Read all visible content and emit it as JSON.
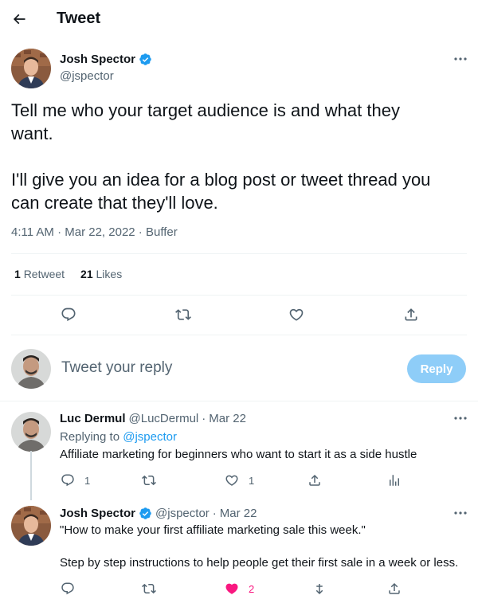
{
  "header": {
    "title": "Tweet"
  },
  "tweet": {
    "author_name": "Josh Spector",
    "author_handle": "@jspector",
    "text": "Tell me who your target audience is and what they\nwant.\n\nI'll give you an idea for a blog post or tweet thread you\ncan create that they'll love.",
    "meta": "4:11 AM · Mar 22, 2022 · Buffer",
    "retweets_count": "1",
    "retweets_label": "Retweet",
    "likes_count": "21",
    "likes_label": "Likes"
  },
  "reply_composer": {
    "placeholder": "Tweet your reply",
    "button_label": "Reply"
  },
  "replies": [
    {
      "name": "Luc Dermul",
      "handle": "@LucDermul",
      "dot": "·",
      "date": "Mar 22",
      "replying_prefix": "Replying to",
      "replying_handle": "@jspector",
      "text": "Affiliate marketing for beginners who want to start it as a side hustle",
      "reply_count": "1",
      "like_count": "1"
    },
    {
      "name": "Josh Spector",
      "handle": "@jspector",
      "dot": "·",
      "date": "Mar 22",
      "text_line1": "\"How to make your first affiliate marketing sale this week.\"",
      "text_line2": "Step by step instructions to help people get their first sale in a week or less.",
      "like_count": "2"
    }
  ],
  "colors": {
    "accent": "#1d9bf0",
    "reply_button_disabled": "#8ecdf8",
    "liked": "#f91880",
    "secondary_text": "#536471"
  },
  "icons": [
    "back-arrow-icon",
    "verified-badge-icon",
    "more-icon",
    "reply-icon",
    "retweet-icon",
    "like-icon",
    "share-icon",
    "analytics-icon",
    "unretweet-icon"
  ]
}
